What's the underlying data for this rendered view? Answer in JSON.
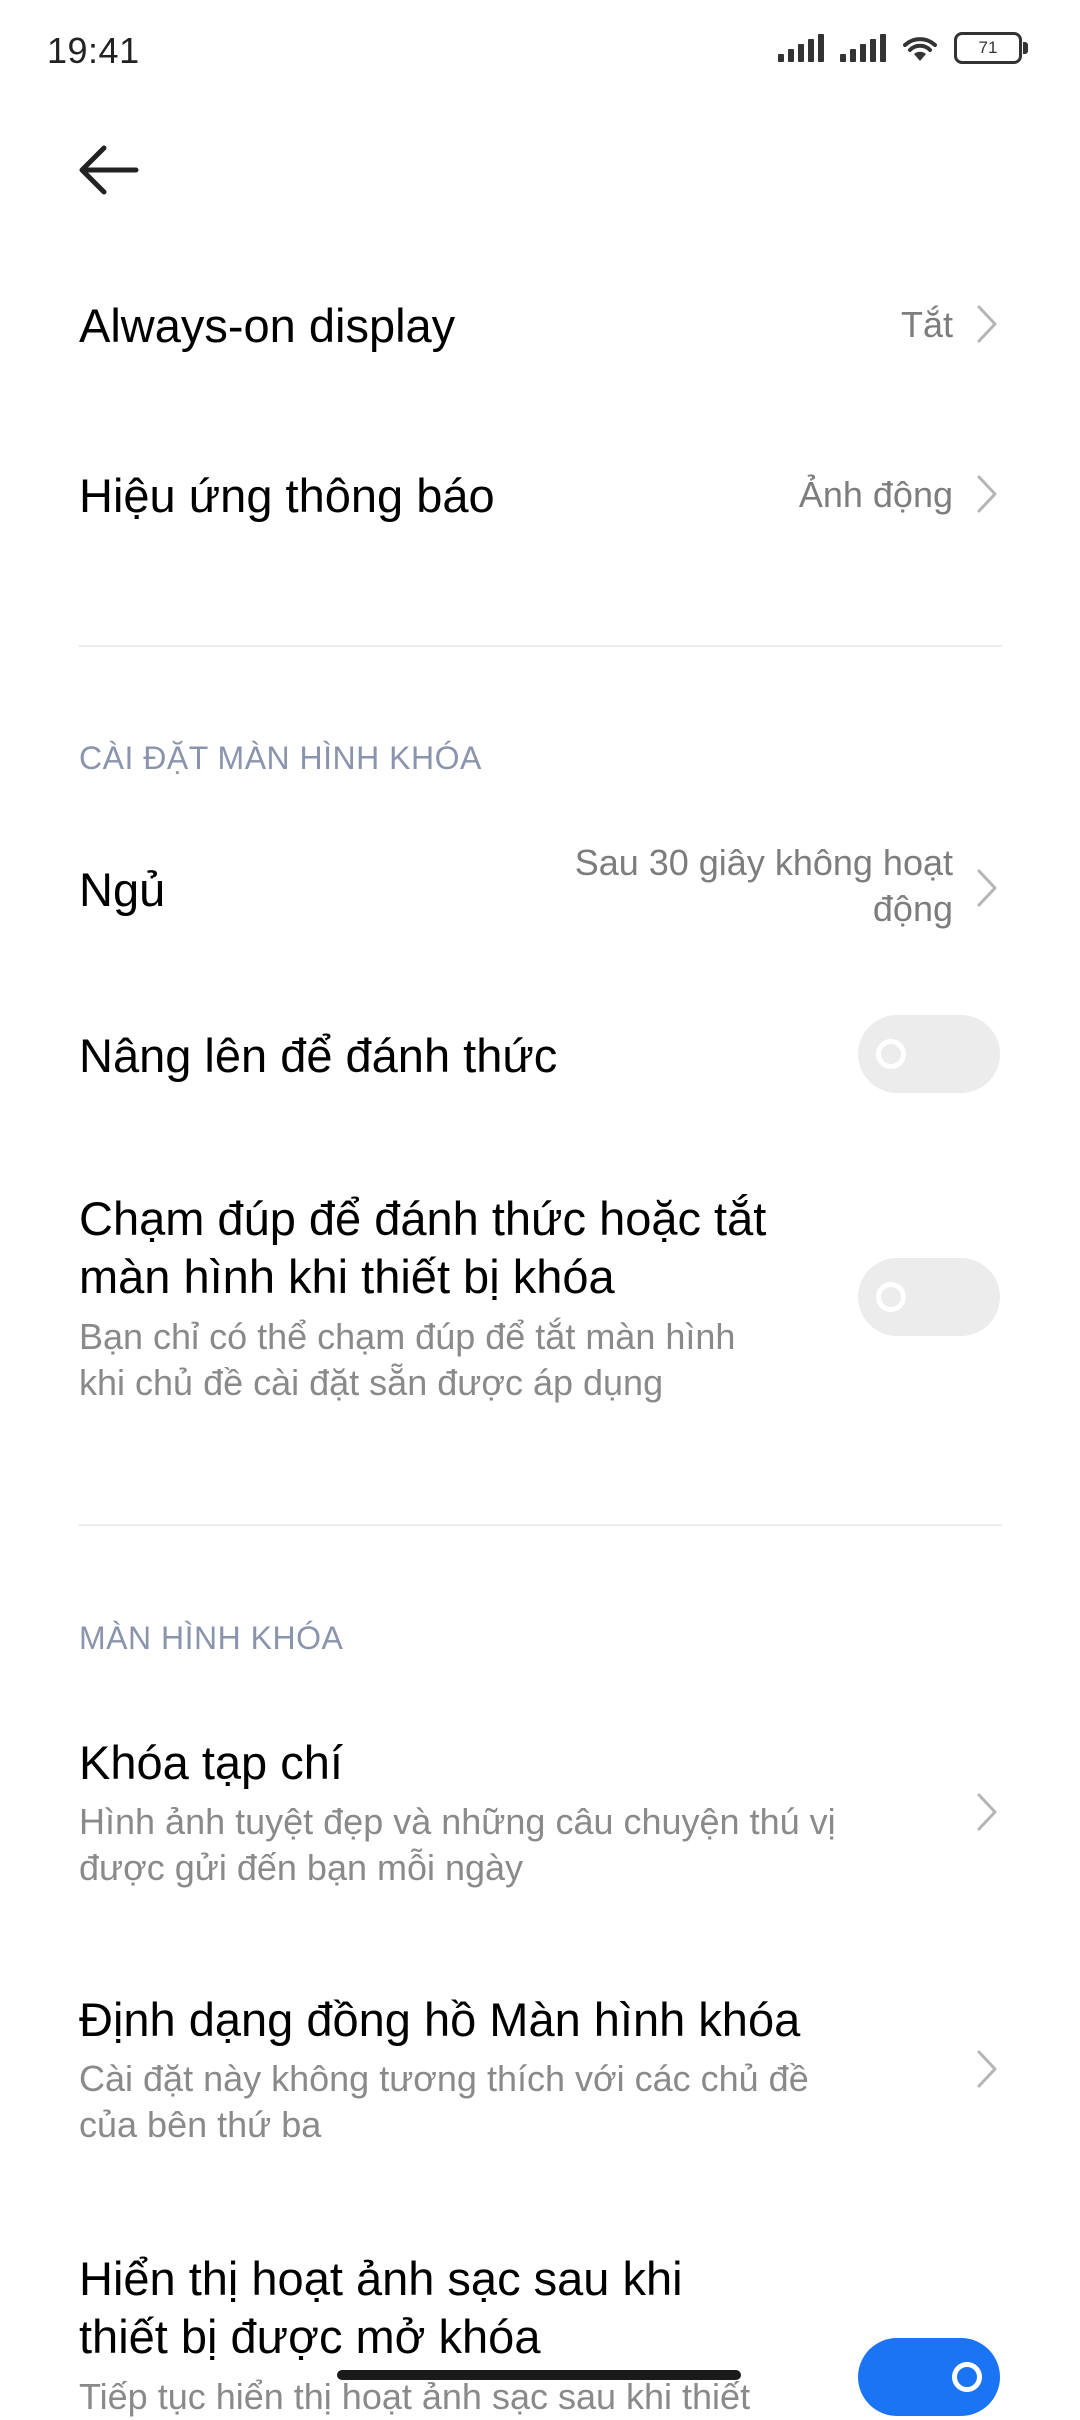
{
  "status_bar": {
    "time": "19:41",
    "battery": "71",
    "icons": [
      "signal-icon",
      "signal-icon",
      "wifi-icon",
      "battery-icon"
    ]
  },
  "rows": {
    "aod": {
      "title": "Always-on display",
      "value": "Tắt"
    },
    "notif_effect": {
      "title": "Hiệu ứng thông báo",
      "value": "Ảnh động"
    }
  },
  "lock_settings": {
    "header": "CÀI ĐẶT MÀN HÌNH KHÓA",
    "sleep": {
      "title": "Ngủ",
      "value_line1": "Sau 30 giây không hoạt",
      "value_line2": "động"
    },
    "raise_wake": {
      "title": "Nâng lên để đánh thức",
      "enabled": false
    },
    "double_tap": {
      "title_line1": "Chạm đúp để đánh thức hoặc tắt",
      "title_line2": "màn hình khi thiết bị khóa",
      "sub_line1": "Bạn chỉ có thể chạm đúp để tắt màn hình",
      "sub_line2": "khi chủ đề cài đặt sẵn được áp dụng",
      "enabled": false
    }
  },
  "lock_screen": {
    "header": "MÀN HÌNH KHÓA",
    "magazine": {
      "title": "Khóa tạp chí",
      "sub_line1": "Hình ảnh tuyệt đẹp và những câu chuyện thú vị",
      "sub_line2": "được gửi đến bạn mỗi ngày"
    },
    "clock_format": {
      "title": "Định dạng đồng hồ Màn hình khóa",
      "sub_line1": "Cài đặt này không tương thích với các chủ đề",
      "sub_line2": "của bên thứ ba"
    },
    "charging_anim": {
      "title_line1": "Hiển thị hoạt ảnh sạc sau khi",
      "title_line2": "thiết bị được mở khóa",
      "sub_line1": "Tiếp tục hiển thị hoạt ảnh sạc sau khi thiết",
      "enabled": true
    }
  },
  "colors": {
    "accent": "#1b74f4",
    "section_header": "#8a94ad"
  }
}
